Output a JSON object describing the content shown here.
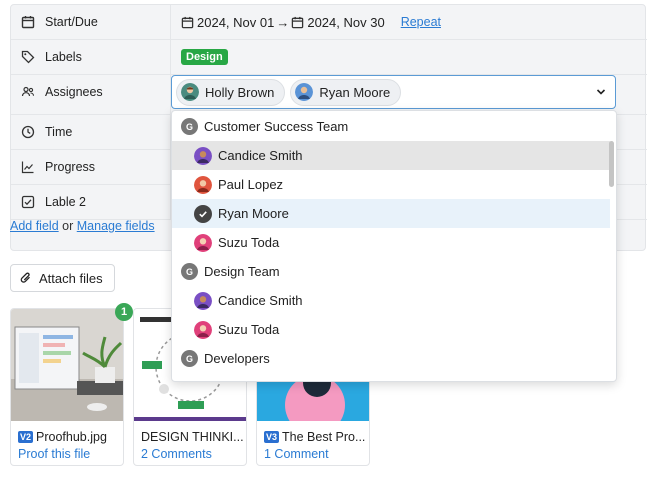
{
  "fields": {
    "start_due": {
      "label": "Start/Due",
      "start": "2024, Nov 01",
      "arrow": "→",
      "end": "2024, Nov 30",
      "repeat": "Repeat"
    },
    "labels": {
      "label": "Labels",
      "tag": "Design",
      "tag_color": "#28a745"
    },
    "assignees": {
      "label": "Assignees",
      "chips": [
        {
          "name": "Holly Brown"
        },
        {
          "name": "Ryan Moore"
        }
      ]
    },
    "time": {
      "label": "Time"
    },
    "progress": {
      "label": "Progress"
    },
    "lable2": {
      "label": "Lable 2"
    }
  },
  "footer": {
    "add_field": "Add field",
    "or": "or",
    "manage_fields": "Manage fields"
  },
  "attach": {
    "label": "Attach files"
  },
  "attachments": [
    {
      "version": "V2",
      "name": "Proofhub.jpg",
      "sub": "Proof this file",
      "badge": "1"
    },
    {
      "version": "",
      "name": "DESIGN THINKI...",
      "sub": "2 Comments"
    },
    {
      "version": "V3",
      "name": "The Best Pro...",
      "sub": "1 Comment"
    }
  ],
  "dropdown": {
    "options": [
      {
        "type": "group",
        "icon": "G",
        "label": "Customer Success Team"
      },
      {
        "type": "user",
        "label": "Candice Smith",
        "state": "hover"
      },
      {
        "type": "user",
        "label": "Paul Lopez"
      },
      {
        "type": "user",
        "label": "Ryan Moore",
        "state": "selected"
      },
      {
        "type": "user",
        "label": "Suzu Toda"
      },
      {
        "type": "group",
        "icon": "G",
        "label": "Design Team"
      },
      {
        "type": "user",
        "label": "Candice Smith"
      },
      {
        "type": "user",
        "label": "Suzu Toda"
      },
      {
        "type": "group",
        "icon": "G",
        "label": "Developers"
      }
    ]
  },
  "colors": {
    "link": "#2a7bd3",
    "focus_border": "#5b9bd5",
    "version_badge": "#2a6fd0",
    "count_badge": "#3aa757"
  }
}
